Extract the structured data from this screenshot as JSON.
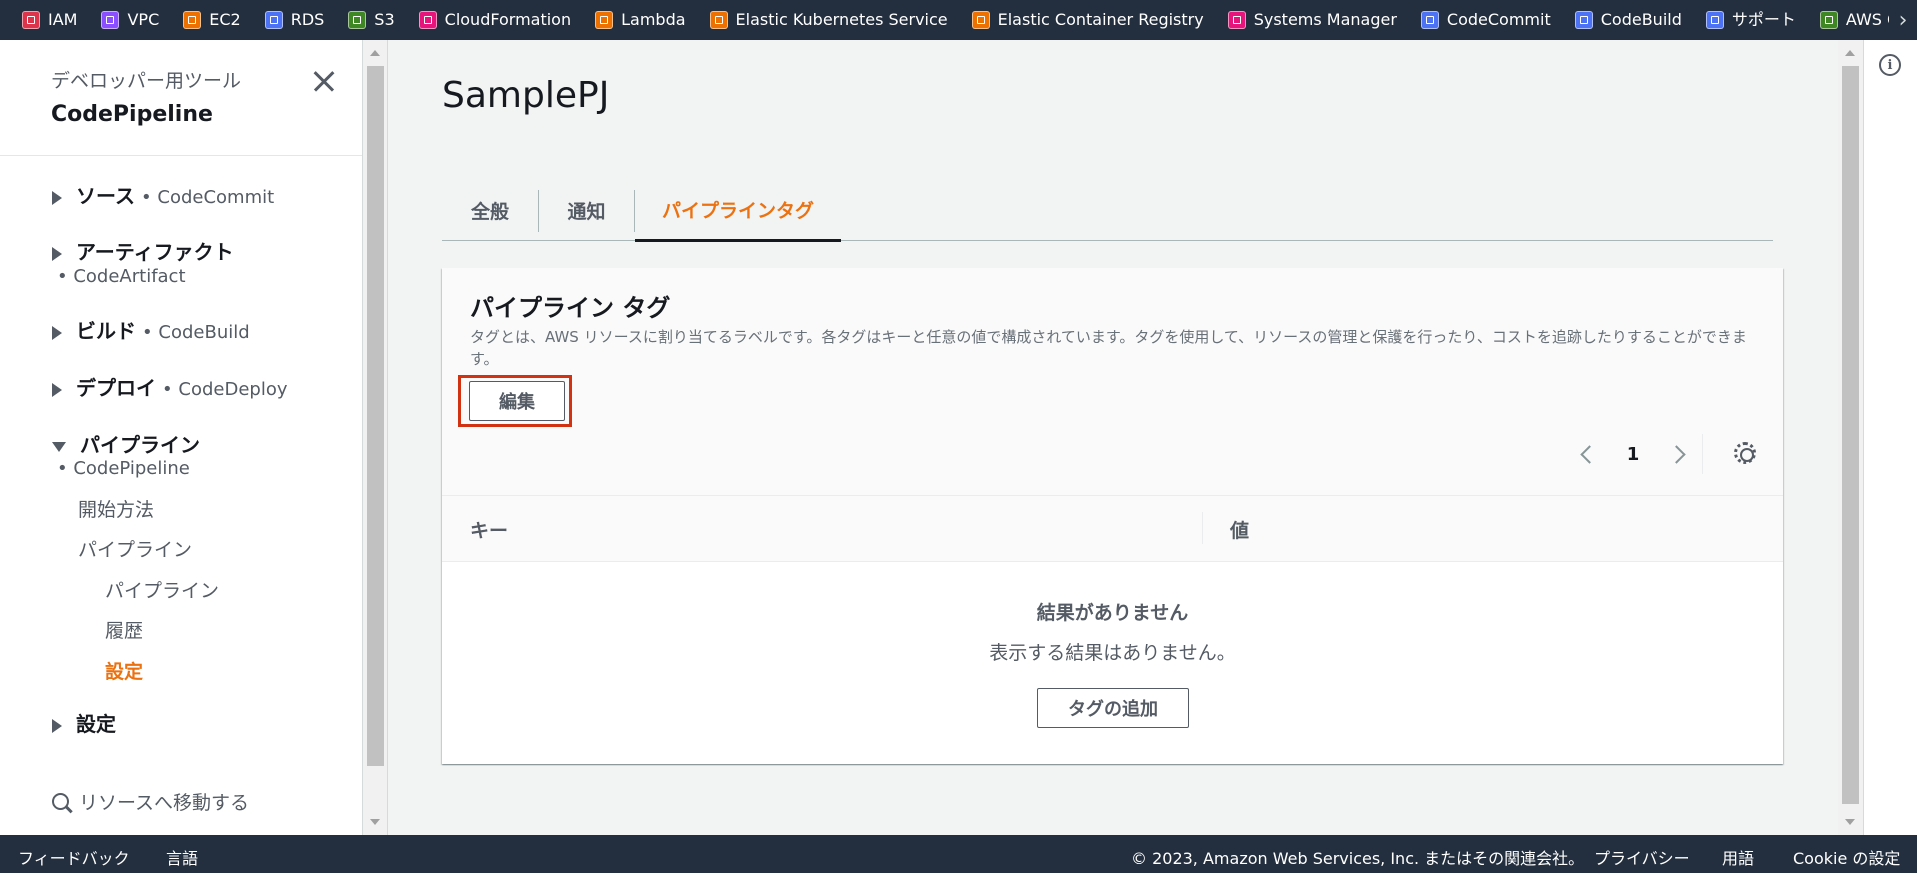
{
  "favorites_bar": {
    "items": [
      {
        "label": "IAM",
        "icon": "iam-icon",
        "color": "#dd344c"
      },
      {
        "label": "VPC",
        "icon": "vpc-icon",
        "color": "#8c4fff"
      },
      {
        "label": "EC2",
        "icon": "ec2-icon",
        "color": "#ed7100"
      },
      {
        "label": "RDS",
        "icon": "rds-icon",
        "color": "#4d72f3"
      },
      {
        "label": "S3",
        "icon": "s3-icon",
        "color": "#3f8624"
      },
      {
        "label": "CloudFormation",
        "icon": "cloudformation-icon",
        "color": "#e7157b"
      },
      {
        "label": "Lambda",
        "icon": "lambda-icon",
        "color": "#ed7100"
      },
      {
        "label": "Elastic Kubernetes Service",
        "icon": "eks-icon",
        "color": "#ed7100"
      },
      {
        "label": "Elastic Container Registry",
        "icon": "ecr-icon",
        "color": "#ed7100"
      },
      {
        "label": "Systems Manager",
        "icon": "systems-manager-icon",
        "color": "#e7157b"
      },
      {
        "label": "CodeCommit",
        "icon": "codecommit-icon",
        "color": "#4d72f3"
      },
      {
        "label": "CodeBuild",
        "icon": "codebuild-icon",
        "color": "#4d72f3"
      },
      {
        "label": "サポート",
        "icon": "support-icon",
        "color": "#4d72f3"
      },
      {
        "label": "AWS Cost Exp",
        "icon": "cost-explorer-icon",
        "color": "#3f8624"
      }
    ],
    "scroll_icon": "chevron-right-icon"
  },
  "sidebar": {
    "subtitle": "デベロッパー用ツール",
    "title": "CodePipeline",
    "close_icon": "close-icon",
    "sections": {
      "source": {
        "label": "ソース",
        "service": "• CodeCommit"
      },
      "artifact": {
        "label": "アーティファクト",
        "service": "• CodeArtifact"
      },
      "build": {
        "label": "ビルド",
        "service": "• CodeBuild"
      },
      "deploy": {
        "label": "デプロイ",
        "service": "• CodeDeploy"
      },
      "pipeline": {
        "label": "パイプライン",
        "service": "• CodePipeline"
      },
      "settings": {
        "label": "設定"
      }
    },
    "pipeline_links": {
      "getting_started": "開始方法",
      "pipelines": "パイプライン",
      "pipeline": "パイプライン",
      "history": "履歴",
      "settings": "設定"
    },
    "search": {
      "label": "リソースへ移動する",
      "icon": "search-icon"
    }
  },
  "main": {
    "page_title": "SamplePJ",
    "tabs": [
      "全般",
      "通知",
      "パイプラインタグ"
    ],
    "active_tab": "パイプラインタグ",
    "panel": {
      "title": "パイプライン タグ",
      "description": "タグとは、AWS リソースに割り当てるラベルです。各タグはキーと任意の値で構成されています。タグを使用して、リソースの管理と保護を行ったり、コストを追跡したりすることができます。",
      "edit_button": "編集",
      "pagination": {
        "current_page": "1"
      },
      "settings_icon": "gear-icon",
      "columns": [
        "キー",
        "値"
      ],
      "empty_title": "結果がありません",
      "empty_description": "表示する結果はありません。",
      "add_tag_button": "タグの追加"
    }
  },
  "right_panel": {
    "info_icon": "info-icon",
    "info_glyph": "i"
  },
  "footer": {
    "feedback": "フィードバック",
    "language": "言語",
    "copyright": "© 2023, Amazon Web Services, Inc. またはその関連会社。",
    "privacy": "プライバシー",
    "terms": "用語",
    "cookie": "Cookie の設定"
  },
  "colors": {
    "accent": "#ec7211",
    "header_bg": "#232f3e",
    "highlight_box": "#d13212"
  }
}
